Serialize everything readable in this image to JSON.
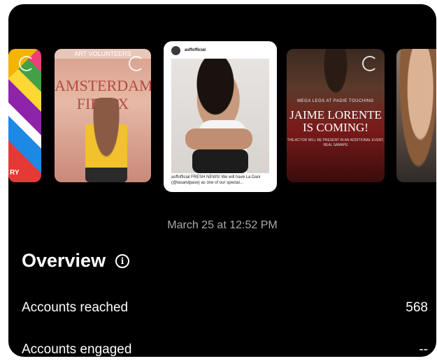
{
  "carousel": {
    "thumb1_label": "RY",
    "thumb2_top": "ART VOLUNTEERS",
    "thumb2_banner": "AMSTERDAM FIEFEX",
    "thumb3_account": "asffofficial",
    "thumb3_caption": "asffofficial FRESH NEWS! We will have La Dani (@lasandpase) as one of our special...",
    "thumb4_subtitle": "MEGA LEGS AT PADIE TOUCHING",
    "thumb4_title": "JAIME LORENTE IS COMING!",
    "thumb4_footer": "THE ACTOR WILL BE PRESENT IN AN ADDITIONAL EVENT, REAL SAMAPE"
  },
  "date": "March 25 at 12:52 PM",
  "overview": {
    "title": "Overview",
    "info_icon": "info-icon"
  },
  "metrics": [
    {
      "label": "Accounts reached",
      "value": "568"
    },
    {
      "label": "Accounts engaged",
      "value": "--"
    }
  ]
}
